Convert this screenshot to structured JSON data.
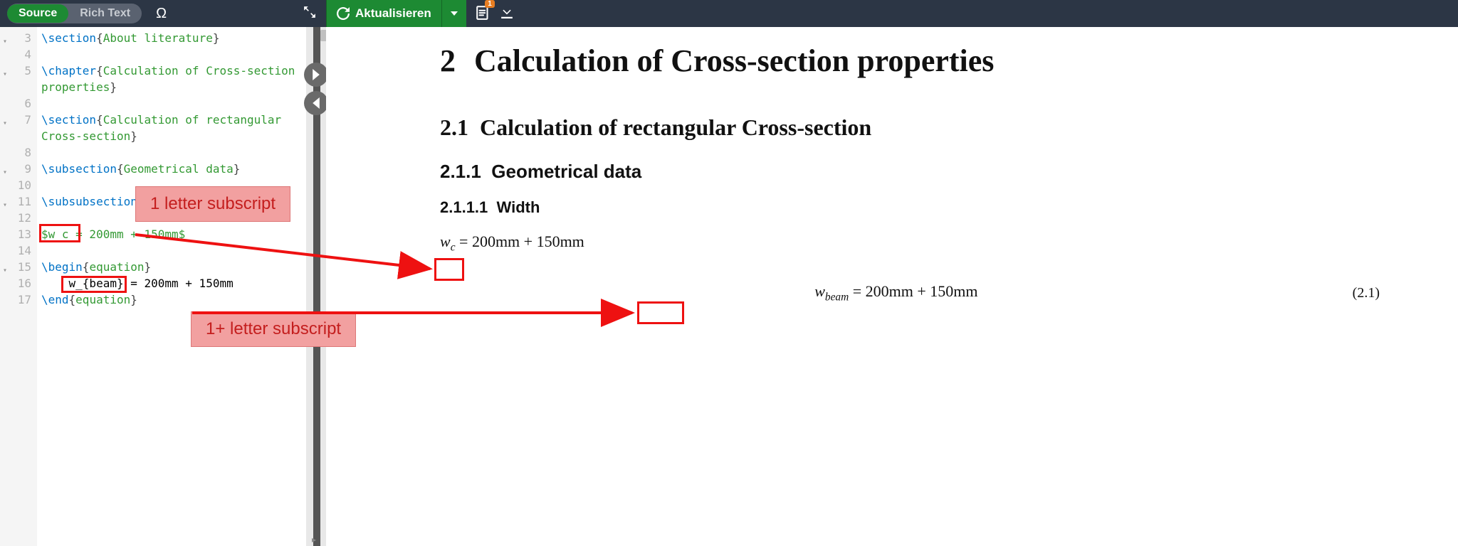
{
  "toolbar": {
    "source_label": "Source",
    "richtext_label": "Rich Text",
    "omega_symbol": "Ω",
    "refresh_label": "Aktualisieren",
    "file_badge": "1"
  },
  "editor": {
    "lines": [
      {
        "n": 3,
        "fold": true,
        "pre": "\\section",
        "arg": "About literature"
      },
      {
        "n": 4
      },
      {
        "n": 5,
        "fold": true,
        "pre": "\\chapter",
        "arg": "Calculation of Cross-section",
        "cont": "properties"
      },
      {
        "n": 6
      },
      {
        "n": 7,
        "fold": true,
        "pre": "\\section",
        "arg": "Calculation of rectangular",
        "cont": "Cross-section"
      },
      {
        "n": 8
      },
      {
        "n": 9,
        "fold": true,
        "pre": "\\subsection",
        "arg": "Geometrical data"
      },
      {
        "n": 10
      },
      {
        "n": 11,
        "fold": true,
        "pre": "\\subsubsection"
      },
      {
        "n": 12
      },
      {
        "n": 13,
        "math": "$w_c = 200mm + 150mm$"
      },
      {
        "n": 14
      },
      {
        "n": 15,
        "fold": true,
        "pre": "\\begin",
        "arg": "equation"
      },
      {
        "n": 16,
        "raw": "    w_{beam} = 200mm + 150mm"
      },
      {
        "n": 17,
        "pre": "\\end",
        "arg": "equation"
      }
    ]
  },
  "preview": {
    "chapter_num": "2",
    "chapter_title": "Calculation of Cross-section properties",
    "section_num": "2.1",
    "section_title": "Calculation of rectangular Cross-section",
    "subsection_num": "2.1.1",
    "subsection_title": "Geometrical data",
    "subsubsection_num": "2.1.1.1",
    "subsubsection_title": "Width",
    "inline_var": "w",
    "inline_sub": "c",
    "inline_rhs": " = 200mm + 150mm",
    "eq_var": "w",
    "eq_sub": "beam",
    "eq_rhs": " = 200mm + 150mm",
    "eq_number": "(2.1)"
  },
  "annotations": {
    "label1": "1 letter subscript",
    "label2": "1+ letter subscript"
  }
}
